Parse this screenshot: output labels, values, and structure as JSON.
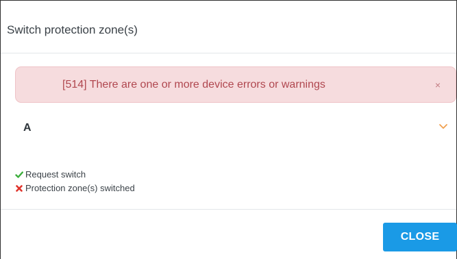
{
  "dialog": {
    "title": "Switch protection zone(s)"
  },
  "alert": {
    "message": "[514] There are one or more device errors or warnings",
    "close_glyph": "×",
    "background_color": "#f6dcde",
    "text_color": "#b0474f"
  },
  "zone": {
    "name": "A",
    "expand_icon": "chevron-down-icon",
    "accent_color": "#f0a050"
  },
  "status_items": [
    {
      "label": "Request switch",
      "icon": "check-icon",
      "state": "success",
      "color": "#3cae3c"
    },
    {
      "label": "Protection zone(s) switched",
      "icon": "x-icon",
      "state": "failed",
      "color": "#e0332b"
    }
  ],
  "footer": {
    "close_label": "CLOSE",
    "button_color": "#1a9ae6"
  }
}
